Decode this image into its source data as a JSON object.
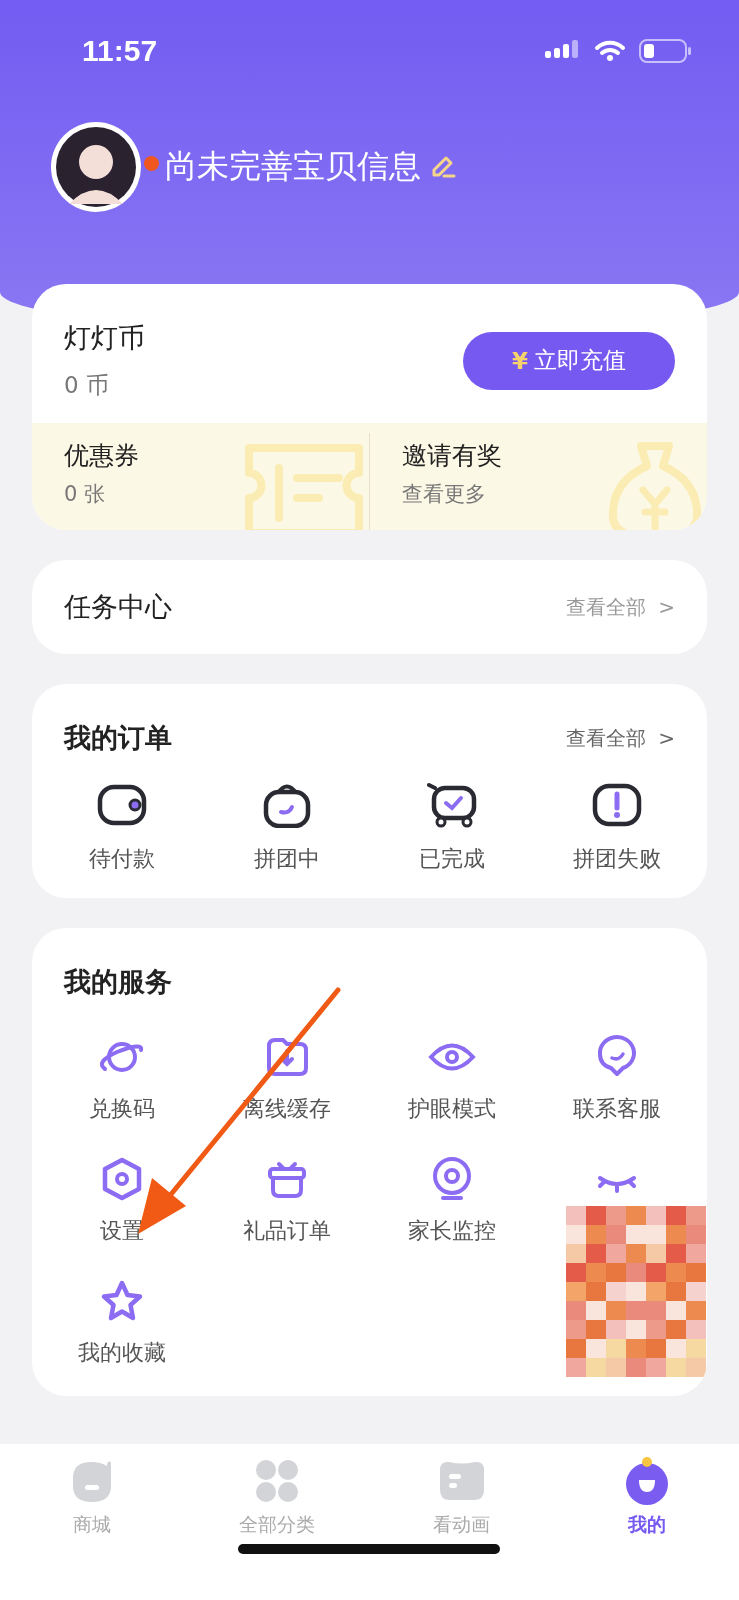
{
  "status_bar": {
    "time": "11:57"
  },
  "profile": {
    "name": "尚未完善宝贝信息",
    "unread_dot": true
  },
  "coins": {
    "title": "灯灯币",
    "amount": "0 币",
    "recharge_button": {
      "symbol": "¥",
      "label": "立即充值"
    }
  },
  "perks": [
    {
      "title": "优惠券",
      "subtitle": "0 张"
    },
    {
      "title": "邀请有奖",
      "subtitle": "查看更多"
    }
  ],
  "task_center": {
    "title": "任务中心",
    "link": "查看全部",
    "chevron": ">"
  },
  "orders": {
    "title": "我的订单",
    "link": "查看全部",
    "chevron": ">",
    "items": [
      {
        "label": "待付款"
      },
      {
        "label": "拼团中"
      },
      {
        "label": "已完成"
      },
      {
        "label": "拼团失败"
      }
    ]
  },
  "services": {
    "title": "我的服务",
    "items": [
      {
        "kind": "item",
        "label": "兑换码"
      },
      {
        "kind": "item",
        "label": "离线缓存"
      },
      {
        "kind": "item",
        "label": "护眼模式"
      },
      {
        "kind": "item",
        "label": "联系客服"
      },
      {
        "kind": "item",
        "label": "设置"
      },
      {
        "kind": "item",
        "label": "礼品订单"
      },
      {
        "kind": "item",
        "label": "家长监控"
      },
      {
        "kind": "redacted"
      },
      {
        "kind": "item",
        "label": "我的收藏"
      }
    ]
  },
  "tab_bar": [
    {
      "label": "商城",
      "selected": false
    },
    {
      "label": "全部分类",
      "selected": false
    },
    {
      "label": "看动画",
      "selected": false
    },
    {
      "label": "我的",
      "selected": true
    }
  ]
}
